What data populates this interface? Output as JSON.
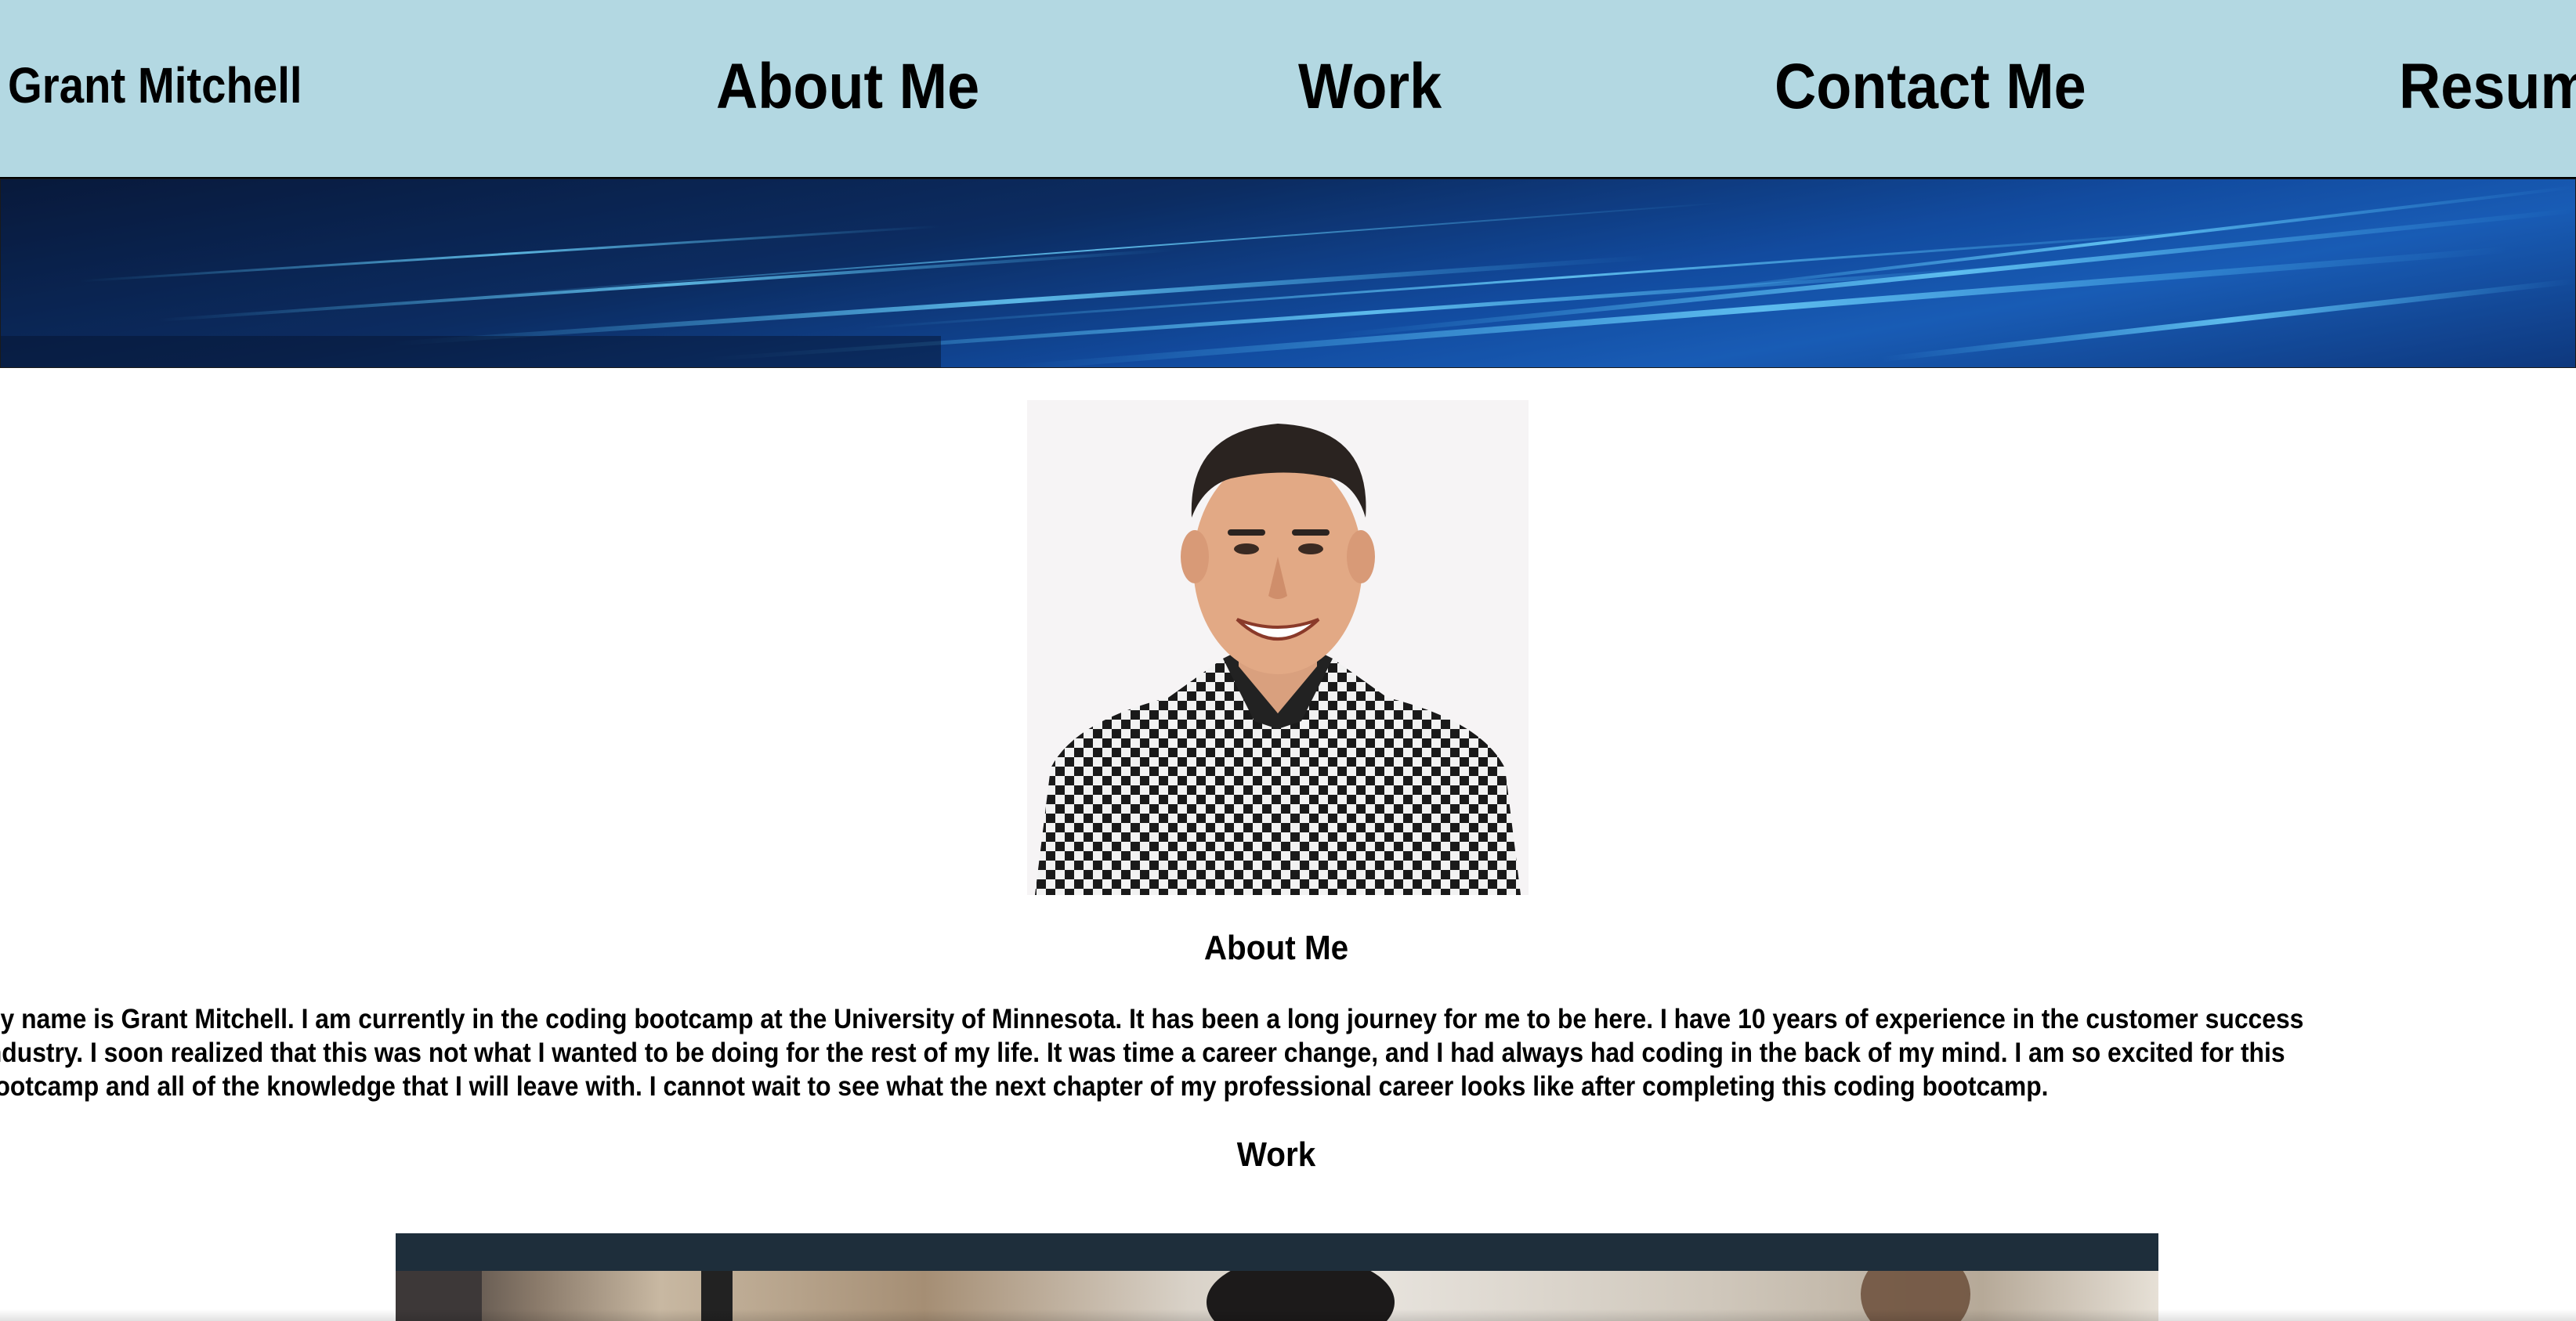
{
  "header": {
    "brand": "Grant Mitchell",
    "nav": [
      {
        "label": "About Me"
      },
      {
        "label": "Work"
      },
      {
        "label": "Contact Me"
      },
      {
        "label": "Resume"
      }
    ],
    "background_color": "#b3d8e2"
  },
  "banner": {
    "image": "blue-digital-light-streaks"
  },
  "about": {
    "portrait": "profile-photo",
    "heading": "About Me",
    "text": "My name is Grant Mitchell. I am currently in the coding bootcamp at the University of Minnesota. It has been a long journey for me to be here. I have 10 years of experience in the customer success industry. I soon realized that this was not what I wanted to be doing for the rest of my life. It was time a career change, and I had always had coding in the back of my mind. I am so excited for this bootcamp and all of the knowledge that I will leave with. I cannot wait to see what the next chapter of my professional career looks like after completing this coding bootcamp."
  },
  "work": {
    "heading": "Work",
    "card_color": "#1e2e3b",
    "image": "project-photo"
  }
}
